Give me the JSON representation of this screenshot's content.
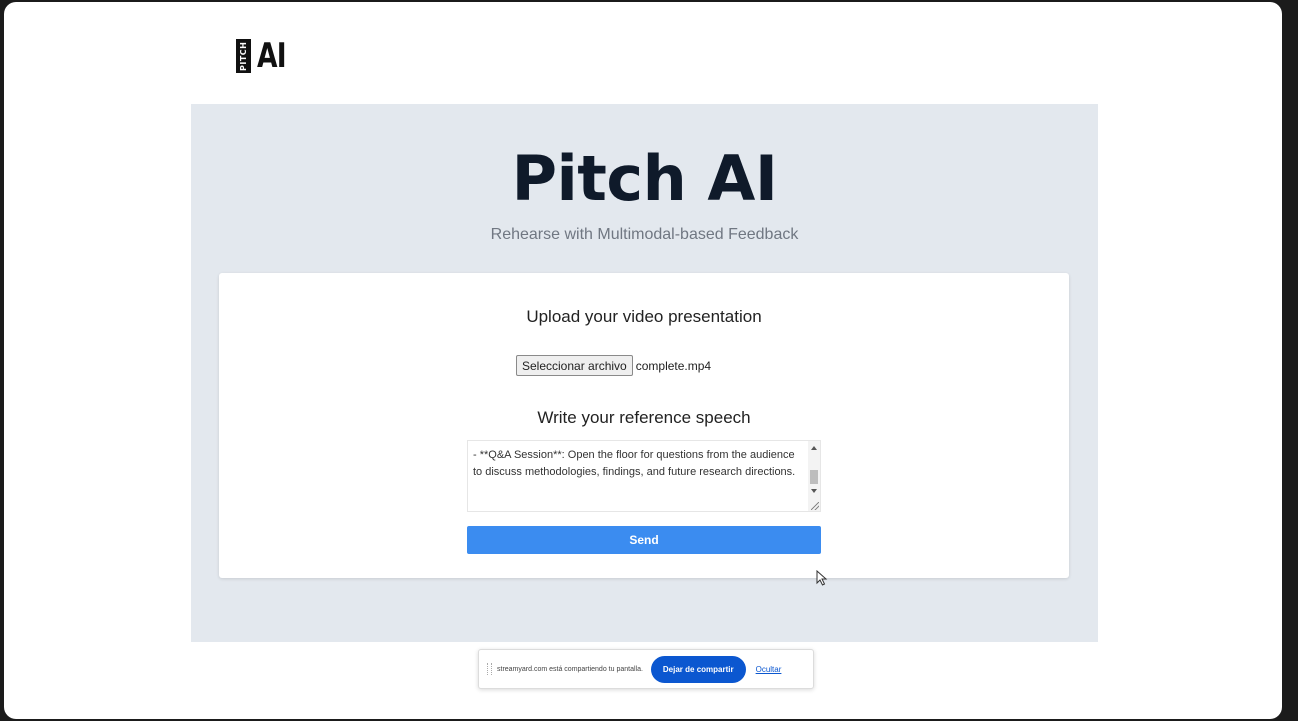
{
  "logo": {
    "badge": "PITCH",
    "text": "AI"
  },
  "hero": {
    "title": "Pitch AI",
    "subtitle": "Rehearse with Multimodal-based Feedback"
  },
  "upload": {
    "heading": "Upload your video presentation",
    "button_label": "Seleccionar archivo",
    "file_name": "complete.mp4"
  },
  "speech": {
    "heading": "Write your reference speech",
    "value": "- **Q&A Session**: Open the floor for questions from the audience to discuss methodologies, findings, and future research directions."
  },
  "send_label": "Send",
  "share_bar": {
    "text": "streamyard.com está compartiendo tu pantalla.",
    "stop_label": "Dejar de compartir",
    "hide_label": "Ocultar"
  },
  "colors": {
    "hero_background": "#e3e8ee",
    "send_button": "#3b8cf0",
    "share_button": "#0b57d0"
  }
}
